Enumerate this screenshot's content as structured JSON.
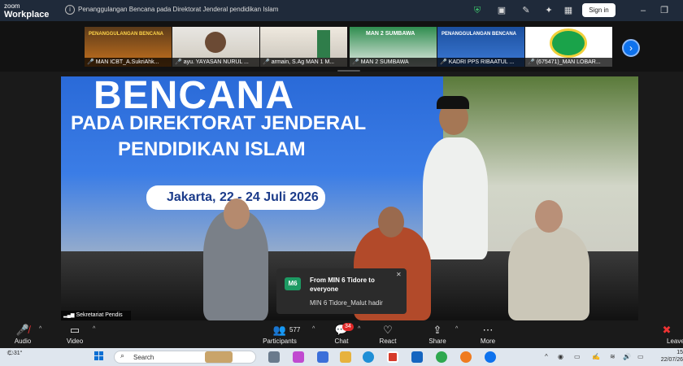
{
  "titlebar": {
    "logo_line1": "zoom",
    "logo_line2": "Workplace",
    "meeting_title": "Penanggulangan Bencana pada Direktorat Jenderal pendidikan Islam",
    "signin_label": "Sign in"
  },
  "thumbnails": [
    {
      "label": "MAN ICBT_A.SukriAhk..."
    },
    {
      "label": "ayu. YAYASAN NURUL ..."
    },
    {
      "label": "armain, S.Ag MAN 1 M..."
    },
    {
      "label": "MAN 2 SUMBAWA"
    },
    {
      "label": "KADRI PPS RIBAATUL ..."
    },
    {
      "label": "(675471)_MAN LOBAR..."
    }
  ],
  "thumb_text": {
    "t1": "PENANGGULANGAN BENCANA",
    "t4": "MAN 2 SUMBAWA",
    "t5": "PENANGGULANGAN BENCANA"
  },
  "main_video": {
    "banner_line1": "BENCANA",
    "banner_line2": "PADA DIREKTORAT JENDERAL",
    "banner_line3": "PENDIDIKAN ISLAM",
    "banner_date": "Jakarta, 22 - 24 Juli 2026",
    "speaker_label": "Sekretariat Pendis"
  },
  "chat_toast": {
    "avatar": "M6",
    "from": "From MIN 6 Tidore to everyone",
    "message": "MIN 6 Tidore_Malut hadir"
  },
  "toolbar": {
    "audio": "Audio",
    "video": "Video",
    "participants": "Participants",
    "participant_count": "577",
    "chat": "Chat",
    "chat_badge": "34",
    "react": "React",
    "share": "Share",
    "more": "More",
    "leave": "Leave"
  },
  "taskbar": {
    "weather": "31°",
    "search_placeholder": "Search",
    "time": "15",
    "date": "22/07/26"
  }
}
